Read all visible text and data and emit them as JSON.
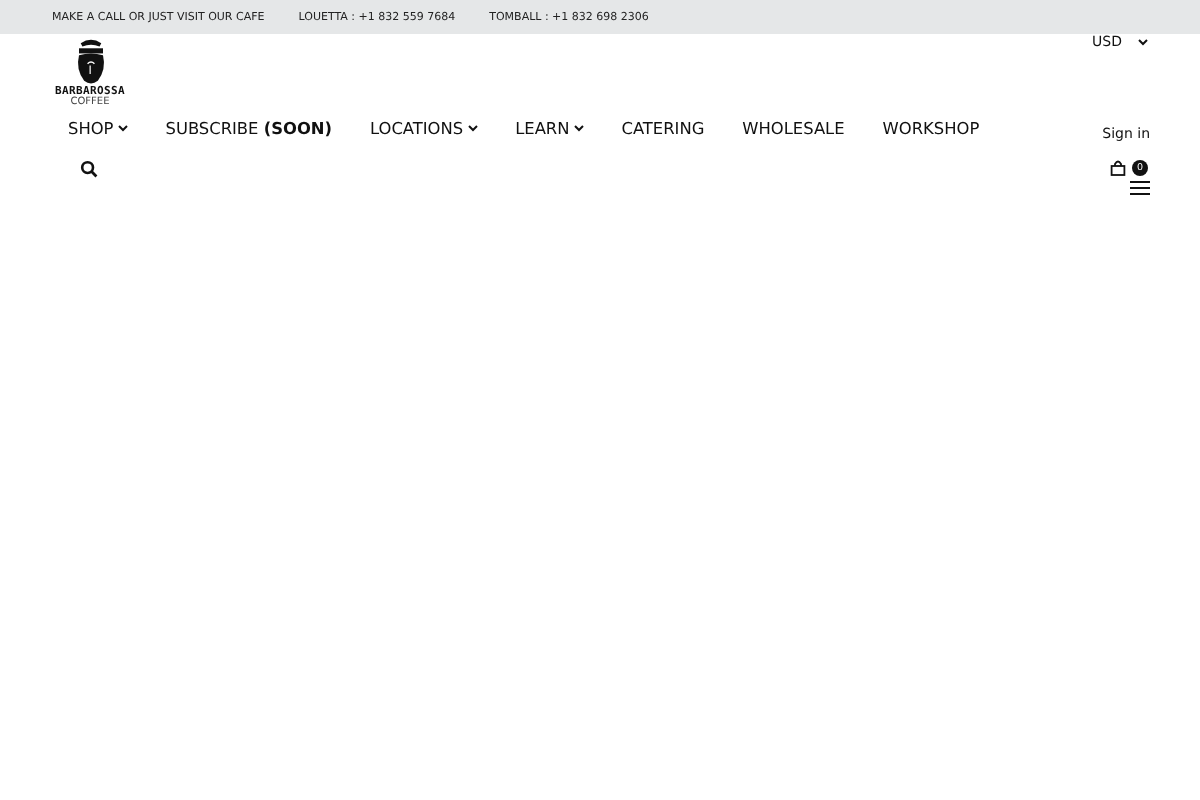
{
  "top_bar": {
    "items": [
      "MAKE A CALL OR JUST VISIT OUR CAFE",
      "LOUETTA : +1 832 559 7684",
      "TOMBALL : +1 832 698 2306"
    ]
  },
  "logo": {
    "name": "BARBAROSSA",
    "tagline": "COFFEE"
  },
  "currency": {
    "value": "USD"
  },
  "nav": [
    {
      "label": "SHOP",
      "dropdown": true
    },
    {
      "label": "SUBSCRIBE",
      "bold_part": "(SOON)",
      "dropdown": false
    },
    {
      "label": "LOCATIONS",
      "dropdown": true
    },
    {
      "label": "LEARN",
      "dropdown": true
    },
    {
      "label": "CATERING",
      "dropdown": false
    },
    {
      "label": "WHOLESALE",
      "dropdown": false
    },
    {
      "label": "WORKSHOP",
      "dropdown": false
    }
  ],
  "account": {
    "sign_in": "Sign in"
  },
  "cart": {
    "count": "0"
  }
}
